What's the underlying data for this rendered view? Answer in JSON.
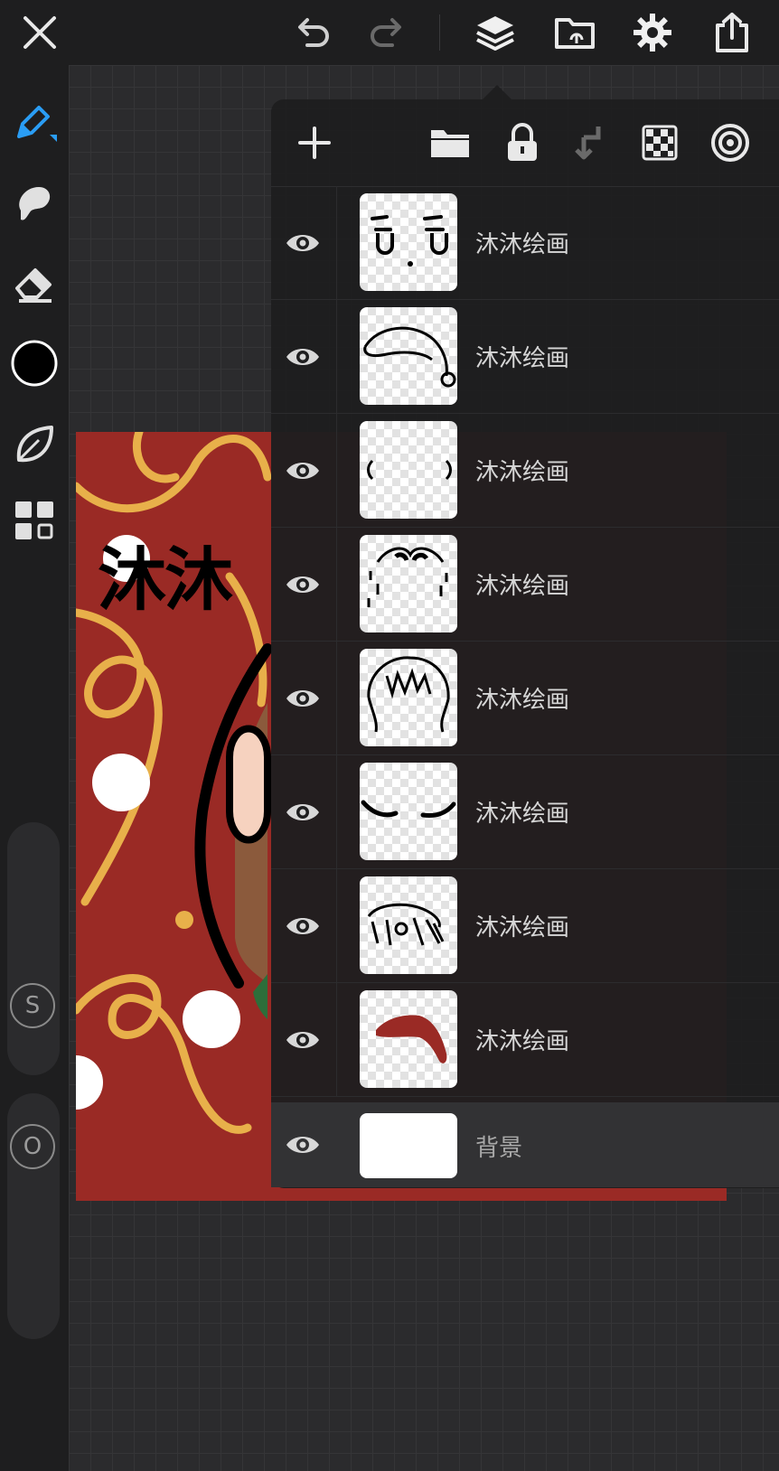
{
  "topbar": {
    "icons": [
      "close-icon",
      "undo-icon",
      "redo-icon",
      "layers-icon",
      "import-icon",
      "settings-icon",
      "share-icon"
    ]
  },
  "sidebar": {
    "tools": [
      "pencil-icon",
      "smudge-icon",
      "eraser-icon",
      "color-swatch",
      "leaf-icon",
      "grid-icon"
    ],
    "current_color": "#000000",
    "size_slider_label": "S",
    "opacity_slider_label": "O"
  },
  "artwork": {
    "canvas_text": "沐沐",
    "background_color": "#9a2a25",
    "accent_color": "#e8b04a"
  },
  "layers_panel": {
    "toolbar_icons": [
      "add-icon",
      "folder-icon",
      "lock-icon",
      "merge-down-icon",
      "alpha-lock-icon",
      "mask-icon"
    ],
    "layers": [
      {
        "name": "沐沐绘画",
        "visible": true
      },
      {
        "name": "沐沐绘画",
        "visible": true
      },
      {
        "name": "沐沐绘画",
        "visible": true
      },
      {
        "name": "沐沐绘画",
        "visible": true
      },
      {
        "name": "沐沐绘画",
        "visible": true
      },
      {
        "name": "沐沐绘画",
        "visible": true
      },
      {
        "name": "沐沐绘画",
        "visible": true
      },
      {
        "name": "沐沐绘画",
        "visible": true
      }
    ],
    "background_layer": {
      "name": "背景",
      "visible": true
    }
  }
}
